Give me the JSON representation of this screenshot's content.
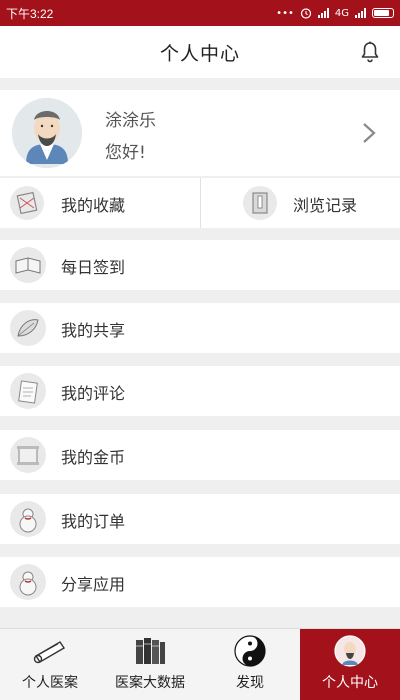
{
  "status_bar": {
    "time": "下午3:22",
    "dots": "•••",
    "network1": "4G"
  },
  "header": {
    "title": "个人中心"
  },
  "profile": {
    "name": "涂涂乐",
    "greeting": "您好!"
  },
  "quick_links": [
    {
      "label": "我的收藏",
      "icon": "bookmark-icon"
    },
    {
      "label": "浏览记录",
      "icon": "history-book-icon"
    }
  ],
  "menu": [
    {
      "label": "每日签到",
      "icon": "book-icon"
    },
    {
      "label": "我的共享",
      "icon": "leaf-icon"
    },
    {
      "label": "我的评论",
      "icon": "paper-icon"
    },
    {
      "label": "我的金币",
      "icon": "scroll-icon"
    },
    {
      "label": "我的订单",
      "icon": "gourd-icon"
    },
    {
      "label": "分享应用",
      "icon": "gourd-share-icon"
    }
  ],
  "tabs": [
    {
      "label": "个人医案",
      "icon": "scroll-roll-icon",
      "active": false
    },
    {
      "label": "医案大数据",
      "icon": "books-icon",
      "active": false
    },
    {
      "label": "发现",
      "icon": "yin-yang-icon",
      "active": false
    },
    {
      "label": "个人中心",
      "icon": "profile-avatar-icon",
      "active": true
    }
  ],
  "colors": {
    "brand": "#a3111b",
    "background": "#efefef"
  }
}
